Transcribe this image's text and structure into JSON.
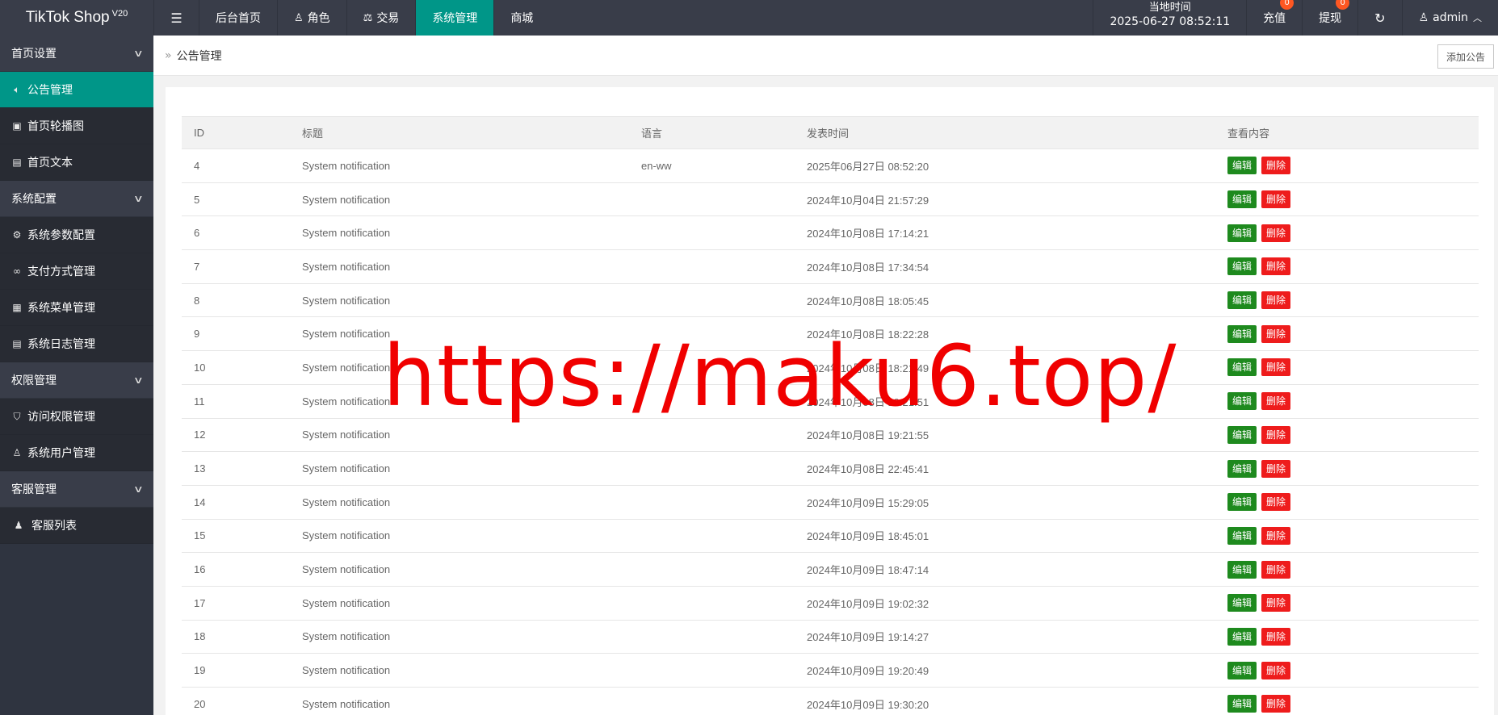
{
  "app": {
    "name": "TikTok Shop",
    "version": "V20"
  },
  "topnav": {
    "items": [
      {
        "label": "后台首页",
        "icon": ""
      },
      {
        "label": "角色",
        "icon": "user-icon"
      },
      {
        "label": "交易",
        "icon": "scale-icon"
      },
      {
        "label": "系统管理",
        "icon": "",
        "active": true
      },
      {
        "label": "商城",
        "icon": ""
      }
    ],
    "time_label": "当地时间",
    "time_value": "2025-06-27 08:52:11",
    "recharge_label": "充值",
    "recharge_badge": "0",
    "withdraw_label": "提现",
    "withdraw_badge": "0",
    "user": "admin"
  },
  "sidebar": {
    "groups": [
      {
        "label": "首页设置",
        "items": [
          {
            "label": "公告管理",
            "icon": "speaker-icon",
            "active": true
          },
          {
            "label": "首页轮播图",
            "icon": "image-icon"
          },
          {
            "label": "首页文本",
            "icon": "document-icon"
          }
        ]
      },
      {
        "label": "系统配置",
        "items": [
          {
            "label": "系统参数配置",
            "icon": "gear-icon"
          },
          {
            "label": "支付方式管理",
            "icon": "link-icon"
          },
          {
            "label": "系统菜单管理",
            "icon": "menu-table-icon"
          },
          {
            "label": "系统日志管理",
            "icon": "log-icon"
          }
        ]
      },
      {
        "label": "权限管理",
        "items": [
          {
            "label": "访问权限管理",
            "icon": "shield-icon"
          },
          {
            "label": "系统用户管理",
            "icon": "user-icon"
          }
        ]
      },
      {
        "label": "客服管理",
        "items": [
          {
            "label": "客服列表",
            "icon": "users-icon"
          }
        ]
      }
    ]
  },
  "breadcrumb": {
    "current": "公告管理"
  },
  "add_button": "添加公告",
  "table": {
    "headers": [
      "ID",
      "标题",
      "语言",
      "发表时间",
      "查看内容"
    ],
    "edit_label": "编辑",
    "delete_label": "删除",
    "rows": [
      {
        "id": "4",
        "title": "System notification",
        "lang": "en-ww",
        "time": "2025年06月27日 08:52:20"
      },
      {
        "id": "5",
        "title": "System notification",
        "lang": "",
        "time": "2024年10月04日 21:57:29"
      },
      {
        "id": "6",
        "title": "System notification",
        "lang": "",
        "time": "2024年10月08日 17:14:21"
      },
      {
        "id": "7",
        "title": "System notification",
        "lang": "",
        "time": "2024年10月08日 17:34:54"
      },
      {
        "id": "8",
        "title": "System notification",
        "lang": "",
        "time": "2024年10月08日 18:05:45"
      },
      {
        "id": "9",
        "title": "System notification",
        "lang": "",
        "time": "2024年10月08日 18:22:28"
      },
      {
        "id": "10",
        "title": "System notification",
        "lang": "",
        "time": "2024年10月08日 18:21:49"
      },
      {
        "id": "11",
        "title": "System notification",
        "lang": "",
        "time": "2024年10月08日 19:21:51"
      },
      {
        "id": "12",
        "title": "System notification",
        "lang": "",
        "time": "2024年10月08日 19:21:55"
      },
      {
        "id": "13",
        "title": "System notification",
        "lang": "",
        "time": "2024年10月08日 22:45:41"
      },
      {
        "id": "14",
        "title": "System notification",
        "lang": "",
        "time": "2024年10月09日 15:29:05"
      },
      {
        "id": "15",
        "title": "System notification",
        "lang": "",
        "time": "2024年10月09日 18:45:01"
      },
      {
        "id": "16",
        "title": "System notification",
        "lang": "",
        "time": "2024年10月09日 18:47:14"
      },
      {
        "id": "17",
        "title": "System notification",
        "lang": "",
        "time": "2024年10月09日 19:02:32"
      },
      {
        "id": "18",
        "title": "System notification",
        "lang": "",
        "time": "2024年10月09日 19:14:27"
      },
      {
        "id": "19",
        "title": "System notification",
        "lang": "",
        "time": "2024年10月09日 19:20:49"
      },
      {
        "id": "20",
        "title": "System notification",
        "lang": "",
        "time": "2024年10月09日 19:30:20"
      }
    ]
  },
  "watermark": "https://maku6.top/",
  "colors": {
    "topbar": "#393d49",
    "accent": "#009688",
    "edit": "#1e8a1e",
    "delete": "#ee1c1c",
    "watermark": "#f00000"
  }
}
